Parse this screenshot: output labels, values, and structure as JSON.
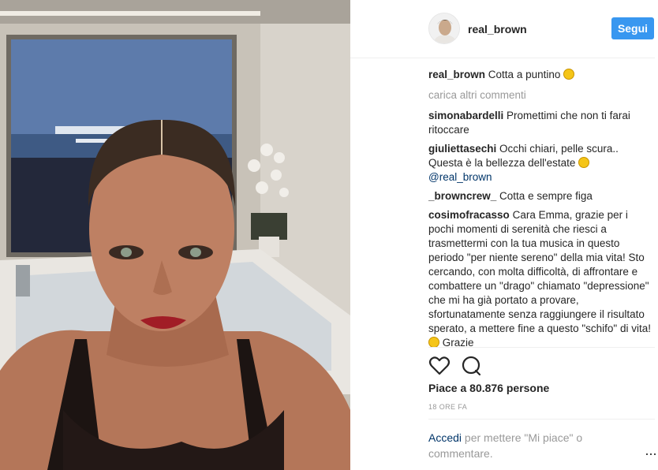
{
  "header": {
    "username": "real_brown",
    "follow_label": "Segui"
  },
  "caption": {
    "user": "real_brown",
    "text": "Cotta a puntino"
  },
  "load_more": "carica altri commenti",
  "comments": [
    {
      "user": "simonabardelli",
      "text": "Promettimi che non ti farai ritoccare"
    },
    {
      "user": "giuliettasechi",
      "text": "Occhi chiari, pelle scura.. Questa è la bellezza dell'estate",
      "mention": "@real_brown"
    },
    {
      "user": "_browncrew_",
      "text": "Cotta e sempre figa"
    },
    {
      "user": "cosimofracasso",
      "text": "Cara Emma, grazie per i pochi momenti di serenità che riesci a trasmettermi con la tua musica in questo periodo \"per niente sereno\" della mia vita! Sto cercando, con molta difficoltà, di affrontare e combattere un \"drago\" chiamato \"depressione\" che mi ha già portato a provare, sfortunatamente senza raggiungere il risultato sperato, a mettere fine a questo \"schifo\" di vita!",
      "tail": "Grazie"
    }
  ],
  "likes": "Piace a 80.876 persone",
  "time": "18 ORE FA",
  "login": {
    "link": "Accedi",
    "text": "per mettere \"Mi piace\" o commentare."
  },
  "more_options": "···",
  "icons": [
    "heart-icon",
    "comment-icon",
    "more-icon"
  ],
  "colors": {
    "follow": "#3897f0",
    "link": "#003569",
    "muted": "#999999"
  }
}
